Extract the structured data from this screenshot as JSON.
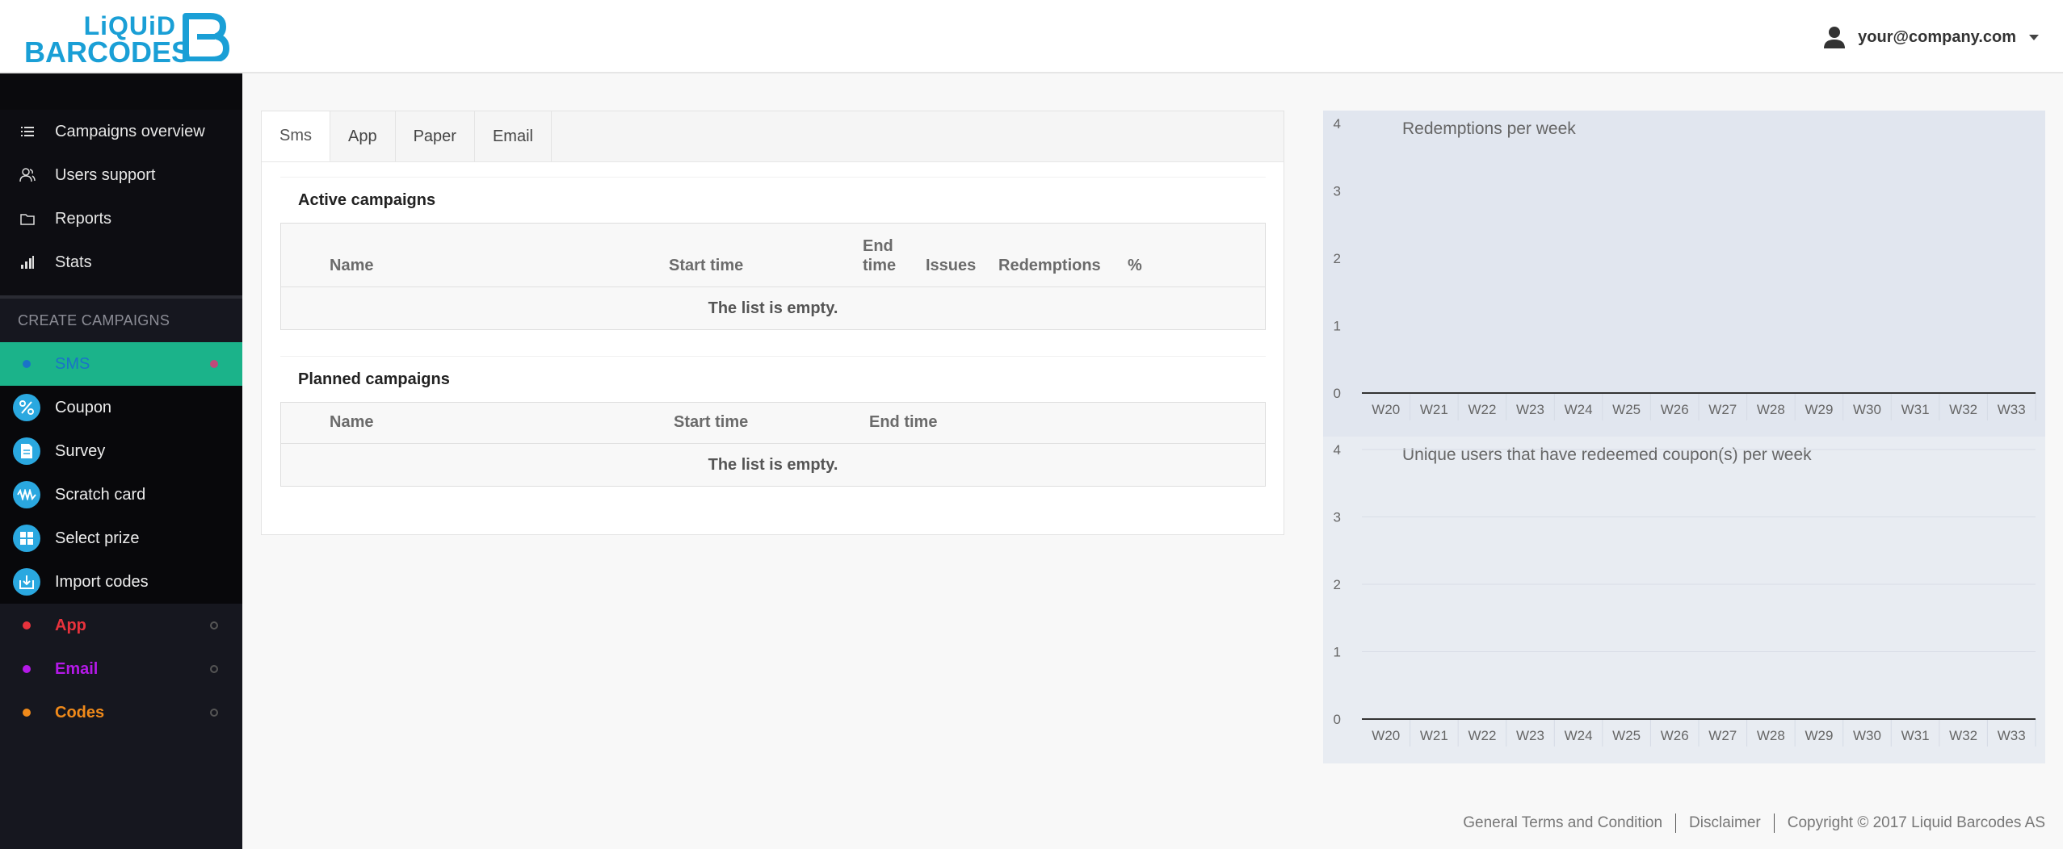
{
  "brand": {
    "line1": "LiQUiD",
    "line2": "BARCODES",
    "color": "#1a9fd6"
  },
  "user": {
    "email": "your@company.com"
  },
  "nav": [
    {
      "label": "Campaigns overview",
      "icon": "list-icon"
    },
    {
      "label": "Users support",
      "icon": "users-icon"
    },
    {
      "label": "Reports",
      "icon": "folder-icon"
    },
    {
      "label": "Stats",
      "icon": "bar-chart-icon"
    }
  ],
  "create_section": "CREATE CAMPAIGNS",
  "campaign_types": {
    "sms": {
      "label": "SMS",
      "color": "#1a73c8"
    },
    "sub": [
      {
        "label": "Coupon",
        "icon": "percent-icon"
      },
      {
        "label": "Survey",
        "icon": "document-icon"
      },
      {
        "label": "Scratch card",
        "icon": "scratch-icon"
      },
      {
        "label": "Select prize",
        "icon": "grid-icon"
      },
      {
        "label": "Import codes",
        "icon": "import-icon"
      }
    ],
    "others": [
      {
        "label": "App",
        "color": "#e8323c"
      },
      {
        "label": "Email",
        "color": "#b419e8"
      },
      {
        "label": "Codes",
        "color": "#f08a1a"
      }
    ]
  },
  "tabs": [
    "Sms",
    "App",
    "Paper",
    "Email"
  ],
  "active_campaigns": {
    "title": "Active campaigns",
    "columns": [
      "Name",
      "Start time",
      "End time",
      "Issues",
      "Redemptions",
      "%"
    ],
    "end_time_lines": [
      "End",
      "time"
    ],
    "empty": "The list is empty."
  },
  "planned_campaigns": {
    "title": "Planned campaigns",
    "columns": [
      "Name",
      "Start time",
      "End time"
    ],
    "empty": "The list is empty."
  },
  "chart_data": [
    {
      "type": "bar",
      "title": "Redemptions per week",
      "categories": [
        "W20",
        "W21",
        "W22",
        "W23",
        "W24",
        "W25",
        "W26",
        "W27",
        "W28",
        "W29",
        "W30",
        "W31",
        "W32",
        "W33"
      ],
      "values": [
        0,
        0,
        0,
        0,
        0,
        0,
        0,
        0,
        0,
        0,
        0,
        0,
        0,
        0
      ],
      "ylim": [
        0,
        4
      ],
      "yticks": [
        0,
        1,
        2,
        3,
        4
      ],
      "grid": false,
      "background": "#e1e6ef"
    },
    {
      "type": "bar",
      "title": "Unique users that have redeemed coupon(s) per week",
      "categories": [
        "W20",
        "W21",
        "W22",
        "W23",
        "W24",
        "W25",
        "W26",
        "W27",
        "W28",
        "W29",
        "W30",
        "W31",
        "W32",
        "W33"
      ],
      "values": [
        0,
        0,
        0,
        0,
        0,
        0,
        0,
        0,
        0,
        0,
        0,
        0,
        0,
        0
      ],
      "ylim": [
        0,
        4
      ],
      "yticks": [
        0,
        1,
        2,
        3,
        4
      ],
      "grid": true,
      "background": "#e8ecf2"
    }
  ],
  "footer": {
    "terms": "General Terms and Condition",
    "disclaimer": "Disclaimer",
    "copyright": "Copyright © 2017 Liquid Barcodes AS"
  }
}
